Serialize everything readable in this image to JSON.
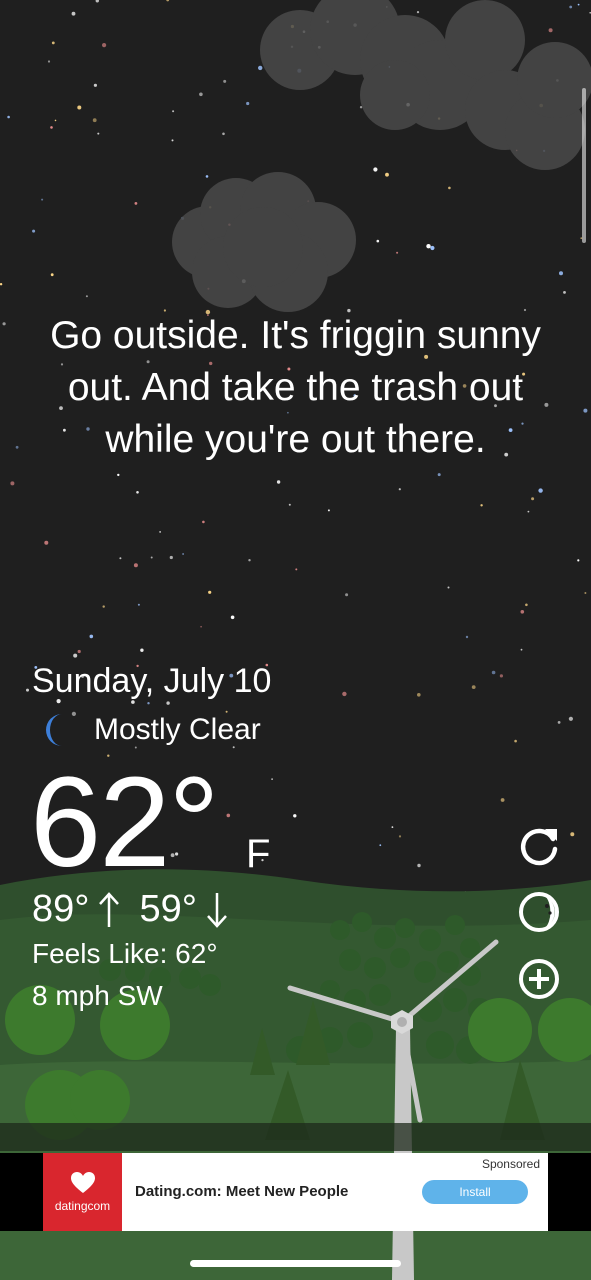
{
  "quote": "Go outside. It's friggin sunny out. And take the trash out while you're out there.",
  "date": "Sunday, July 10",
  "condition": "Mostly Clear",
  "current_temp": "62°",
  "unit": "F",
  "high": "89°",
  "low": "59°",
  "feels_like": "Feels Like: 62°",
  "wind": "8 mph SW",
  "icons": {
    "condition": "moon-icon",
    "refresh": "refresh-icon",
    "theme": "moon-face-icon",
    "add": "add-location-icon"
  },
  "ad": {
    "brand": "datingcom",
    "title": "Dating.com: Meet New People",
    "sponsored": "Sponsored",
    "cta": "Install"
  },
  "colors": {
    "sky": "#1f1f1f",
    "hill": "#3d6638",
    "moon": "#3d7fd9",
    "ad_logo": "#d9262e",
    "install_button": "#5fb3ea"
  }
}
